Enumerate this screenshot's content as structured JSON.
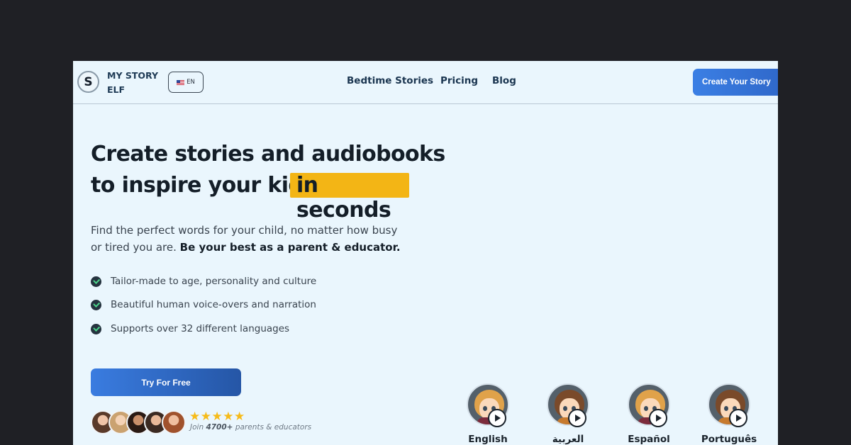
{
  "header": {
    "logo_letter": "S",
    "logo_text": "MY STORY ELF",
    "language_button": "EN",
    "nav": [
      "Bedtime Stories",
      "Pricing",
      "Blog"
    ],
    "cta": "Create Your Story"
  },
  "hero": {
    "headline_line1": "Create stories and audiobooks",
    "headline_line2": "to inspire your kids,",
    "headline_highlight": "in seconds",
    "subtitle_plain": "Find the perfect words for your child, no matter how busy or tired you are.",
    "subtitle_bold": "Be your best as a parent & educator.",
    "features": [
      "Tailor-made to age, personality and culture",
      "Beautiful human voice-overs and narration",
      "Supports over 32 different languages"
    ],
    "try_button": "Try For Free",
    "rating_stars": 5,
    "stars_text": "★★★★★",
    "join_prefix": "Join",
    "join_count": "4700+",
    "join_suffix": "parents & educators"
  },
  "languages": [
    {
      "label": "English",
      "hair_color": "#e0a24a"
    },
    {
      "label": "العربية",
      "hair_color": "#7a4a2a"
    },
    {
      "label": "Español",
      "hair_color": "#e0a24a"
    },
    {
      "label": "Português",
      "hair_color": "#7a4a2a"
    }
  ],
  "colors": {
    "accent_blue": "#3b7fe4",
    "highlight_yellow": "#f3b515",
    "check_green": "#4cd38a",
    "page_bg": "#eaf6fd"
  }
}
